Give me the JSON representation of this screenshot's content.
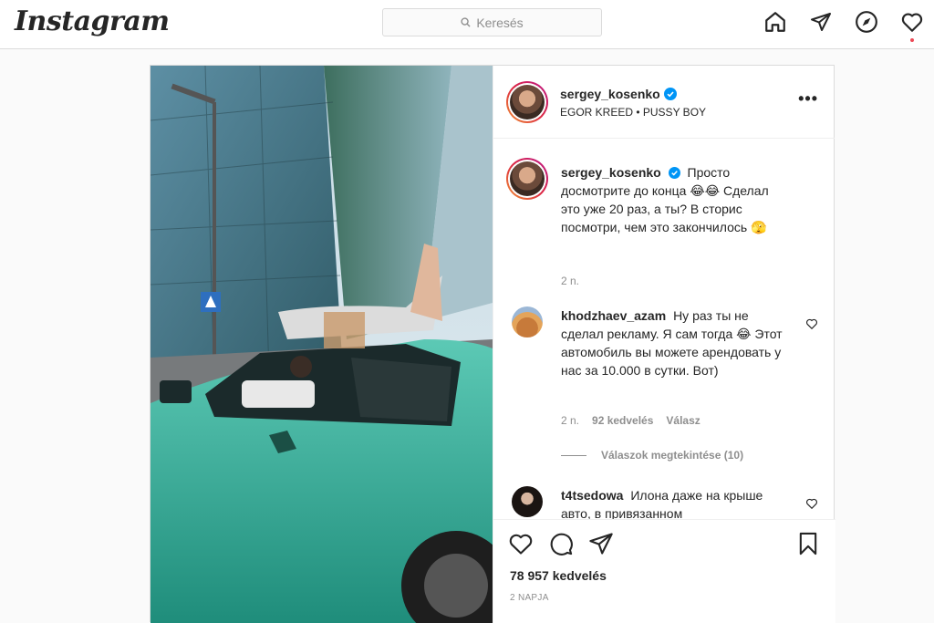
{
  "app": {
    "logo_text": "Instagram"
  },
  "search": {
    "placeholder": "Keresés",
    "icon": "search-icon"
  },
  "nav": {
    "icons": [
      "home-icon",
      "direct-icon",
      "explore-icon",
      "activity-icon"
    ],
    "notification_color": "#ed4956"
  },
  "post": {
    "username": "sergey_kosenko",
    "music": "EGOR KREED • PUSSY BOY",
    "caption": "Просто досмотрите до конца 😂😂 Сделал это уже 20 раз, а ты? В сторис посмотри, чем это закончилось 🫣",
    "caption_time": "2 n.",
    "likes": "78 957 kedvelés",
    "date": "2 NAPJA"
  },
  "comments": [
    {
      "username": "khodzhaev_azam",
      "text": "Ну раз ты не сделал рекламу. Я сам тогда 😂 Этот автомобиль вы можете арендовать у нас за 10.000 в сутки. Вот)",
      "time": "2 n.",
      "likes": "92 kedvelés",
      "reply_label": "Válasz",
      "view_replies": "Válaszok megtekintése (10)"
    },
    {
      "username": "t4tsedowa",
      "text": "Илона даже на крыше авто, в привязанном"
    }
  ],
  "colors": {
    "accent": "#0095f6",
    "border": "#dbdbdb",
    "muted": "#8e8e8e",
    "car": "#2fae9a"
  }
}
